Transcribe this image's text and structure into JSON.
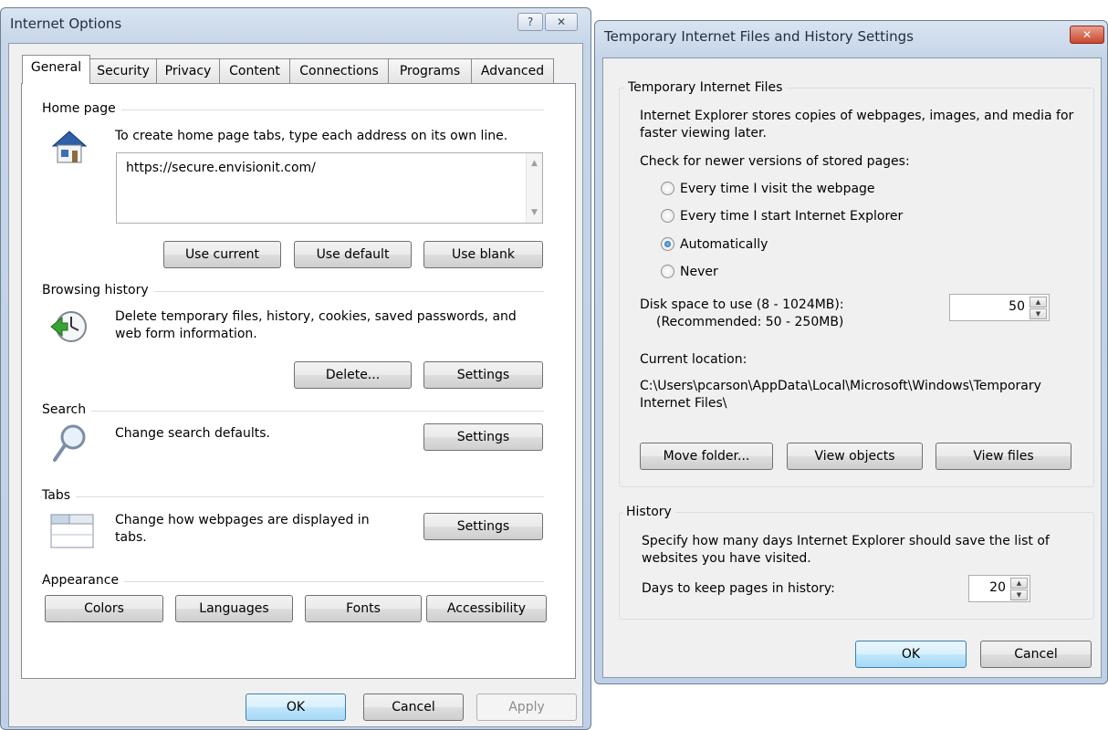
{
  "internet_options": {
    "title": "Internet Options",
    "help_button": "?",
    "close_button": "✕",
    "tabs": [
      {
        "label": "General"
      },
      {
        "label": "Security"
      },
      {
        "label": "Privacy"
      },
      {
        "label": "Content"
      },
      {
        "label": "Connections"
      },
      {
        "label": "Programs"
      },
      {
        "label": "Advanced"
      }
    ],
    "home_page": {
      "section_label": "Home page",
      "description": "To create home page tabs, type each address on its own line.",
      "url_value": "https://secure.envisionit.com/",
      "use_current": "Use current",
      "use_default": "Use default",
      "use_blank": "Use blank"
    },
    "browsing_history": {
      "section_label": "Browsing history",
      "description": "Delete temporary files, history, cookies, saved passwords, and web form information.",
      "delete": "Delete...",
      "settings": "Settings"
    },
    "search": {
      "section_label": "Search",
      "description": "Change search defaults.",
      "settings": "Settings"
    },
    "tabs_section": {
      "section_label": "Tabs",
      "description": "Change how webpages are displayed in tabs.",
      "settings": "Settings"
    },
    "appearance": {
      "section_label": "Appearance",
      "colors": "Colors",
      "languages": "Languages",
      "fonts": "Fonts",
      "accessibility": "Accessibility"
    },
    "footer": {
      "ok": "OK",
      "cancel": "Cancel",
      "apply": "Apply"
    }
  },
  "temp_files_settings": {
    "title": "Temporary Internet Files and History Settings",
    "close_button": "✕",
    "temporary_files": {
      "group_label": "Temporary Internet Files",
      "description": "Internet Explorer stores copies of webpages, images, and media for faster viewing later.",
      "check_label": "Check for newer versions of stored pages:",
      "options": [
        {
          "label": "Every time I visit the webpage",
          "checked": false
        },
        {
          "label": "Every time I start Internet Explorer",
          "checked": false
        },
        {
          "label": "Automatically",
          "checked": true
        },
        {
          "label": "Never",
          "checked": false
        }
      ],
      "disk_space_label": "Disk space to use (8 - 1024MB):",
      "disk_space_recommended": "(Recommended: 50 - 250MB)",
      "disk_space_value": "50",
      "current_location_label": "Current location:",
      "current_location_path": "C:\\Users\\pcarson\\AppData\\Local\\Microsoft\\Windows\\Temporary Internet Files\\",
      "move_folder": "Move folder...",
      "view_objects": "View objects",
      "view_files": "View files"
    },
    "history": {
      "group_label": "History",
      "description": "Specify how many days Internet Explorer should save the list of websites you have visited.",
      "days_label": "Days to keep pages in history:",
      "days_value": "20"
    },
    "footer": {
      "ok": "OK",
      "cancel": "Cancel"
    }
  }
}
